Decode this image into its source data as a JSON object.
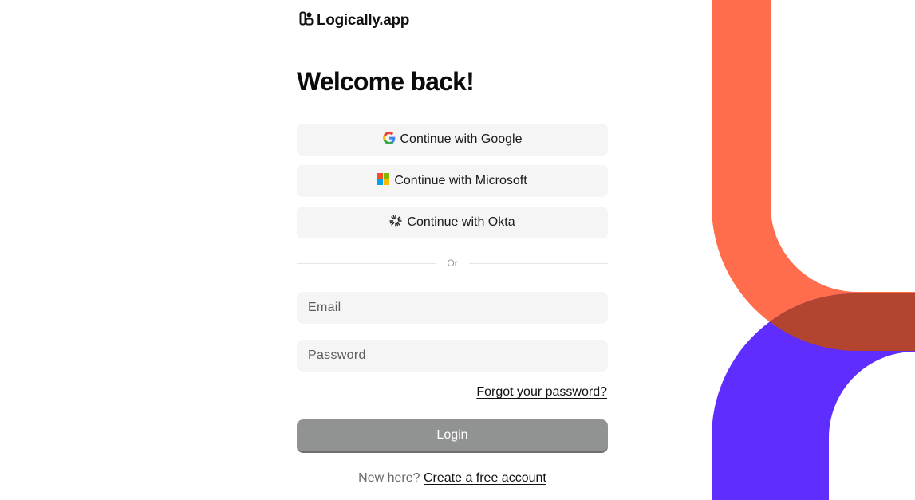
{
  "brand": {
    "name": "Logically.app",
    "icon": "logically-logo-icon"
  },
  "heading": "Welcome back!",
  "sso": {
    "google": {
      "label": "Continue with Google",
      "icon": "google-icon"
    },
    "microsoft": {
      "label": "Continue with Microsoft",
      "icon": "microsoft-icon"
    },
    "okta": {
      "label": "Continue with Okta",
      "icon": "okta-icon"
    }
  },
  "divider_text": "Or",
  "form": {
    "email": {
      "placeholder": "Email",
      "value": ""
    },
    "password": {
      "placeholder": "Password",
      "value": ""
    },
    "forgot_label": "Forgot your password?",
    "login_label": "Login"
  },
  "signup": {
    "prompt": "New here?",
    "link_label": "Create a free account"
  },
  "colors": {
    "decor_orange": "#FF6D4D",
    "decor_purple": "#5F2EFF",
    "decor_overlap": "#B3442F",
    "login_button": "#919392",
    "input_background": "#F5F5F5"
  }
}
